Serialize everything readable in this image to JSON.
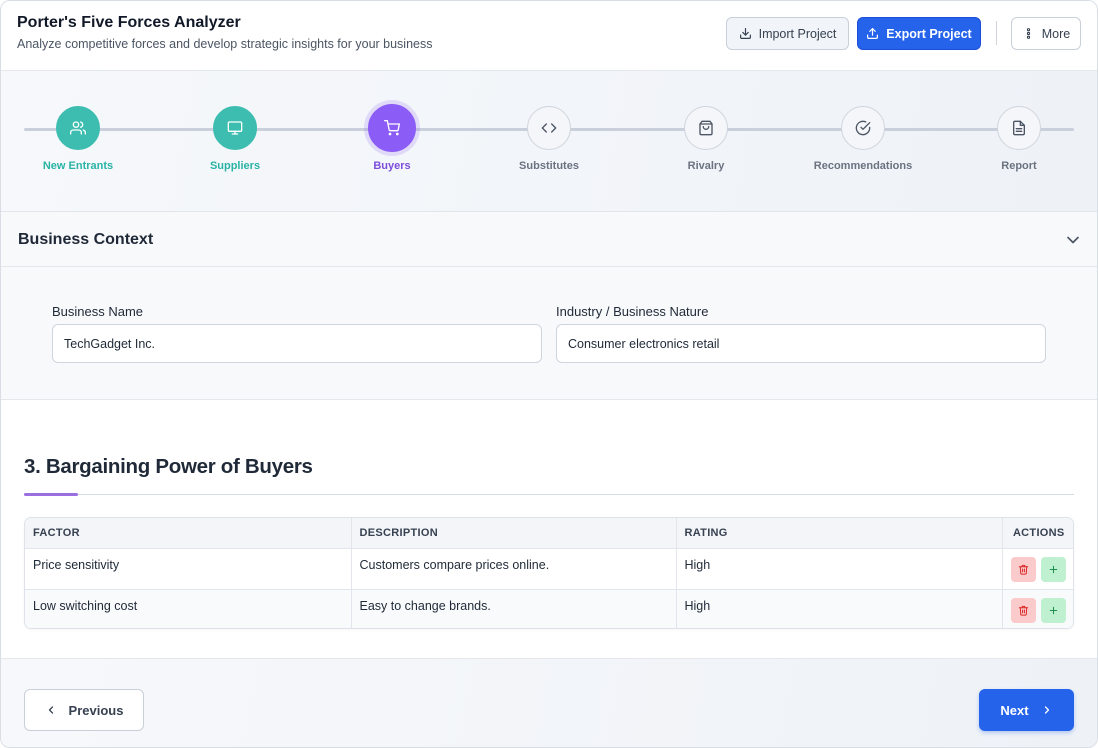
{
  "header": {
    "title": "Porter's Five Forces Analyzer",
    "subtitle": "Analyze competitive forces and develop strategic insights for your business",
    "import_label": "Import Project",
    "export_label": "Export Project",
    "more_label": "More"
  },
  "stepper": {
    "steps": [
      {
        "label": "New Entrants",
        "icon": "users-icon",
        "state": "done"
      },
      {
        "label": "Suppliers",
        "icon": "monitor-icon",
        "state": "done"
      },
      {
        "label": "Buyers",
        "icon": "shopping-cart-icon",
        "state": "active"
      },
      {
        "label": "Substitutes",
        "icon": "code-icon",
        "state": "pending"
      },
      {
        "label": "Rivalry",
        "icon": "shopping-bag-icon",
        "state": "pending"
      },
      {
        "label": "Recommendations",
        "icon": "check-circle-icon",
        "state": "pending"
      },
      {
        "label": "Report",
        "icon": "file-text-icon",
        "state": "pending"
      }
    ]
  },
  "context": {
    "title": "Business Context",
    "business_name_label": "Business Name",
    "business_name_value": "TechGadget Inc.",
    "industry_label": "Industry / Business Nature",
    "industry_value": "Consumer electronics retail"
  },
  "section": {
    "title": "3. Bargaining Power of Buyers"
  },
  "table": {
    "headers": {
      "factor": "FACTOR",
      "description": "DESCRIPTION",
      "rating": "RATING",
      "actions": "ACTIONS"
    },
    "rows": [
      {
        "factor": "Price sensitivity",
        "description": "Customers compare prices online.",
        "rating": "High"
      },
      {
        "factor": "Low switching cost",
        "description": "Easy to change brands.",
        "rating": "High"
      }
    ]
  },
  "footer": {
    "prev_label": "Previous",
    "next_label": "Next"
  },
  "colors": {
    "primary": "#2563eb",
    "done": "#3dbdb0",
    "active": "#8b5cf6",
    "delete": "#fbcaca",
    "add": "#bff0cf"
  }
}
